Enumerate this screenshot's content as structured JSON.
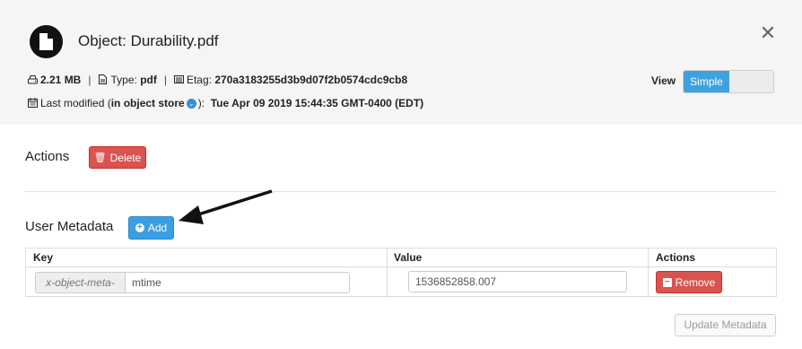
{
  "header": {
    "title": "Object: Durability.pdf",
    "size": "2.21 MB",
    "type_label": "Type:",
    "type_value": "pdf",
    "etag_label": "Etag:",
    "etag_value": "270a3183255d3b9d07f2b0574cdc9cb8",
    "modified_label": "Last modified (",
    "modified_source": "in object store",
    "modified_suffix": "):",
    "modified_value": "Tue Apr 09 2019 15:44:35 GMT-0400 (EDT)",
    "separator": "|"
  },
  "view": {
    "label": "View",
    "selected": "Simple"
  },
  "actions": {
    "label": "Actions",
    "delete_label": "Delete"
  },
  "user_metadata": {
    "label": "User Metadata",
    "add_label": "Add",
    "columns": [
      "Key",
      "Value",
      "Actions"
    ],
    "rows": [
      {
        "key_prefix": "x-object-meta-",
        "key": "mtime",
        "value": "1536852858.007",
        "remove_label": "Remove"
      }
    ],
    "update_label": "Update Metadata"
  },
  "colors": {
    "primary": "#3a9ee0",
    "danger": "#d9534f",
    "header_bg": "#f5f5f5"
  },
  "icons": {
    "file": "file-icon",
    "close": "close-icon",
    "hdd": "hdd-icon",
    "type": "file-type-icon",
    "etag": "etag-icon",
    "calendar": "calendar-icon",
    "info": "info-icon",
    "trash": "trash-icon",
    "plus": "plus-circle-icon",
    "minus": "minus-icon",
    "arrow": "arrow-annotation"
  }
}
